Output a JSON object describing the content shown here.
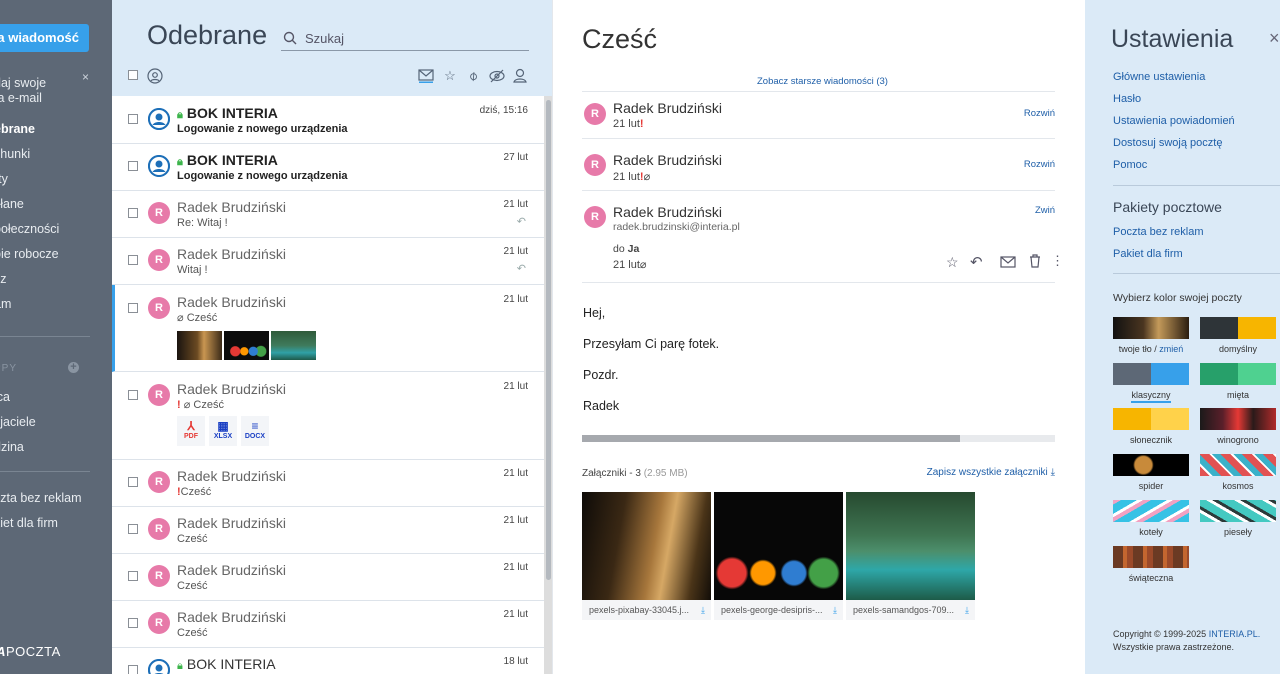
{
  "sidebar": {
    "new_message": "wa wiadomość",
    "promo": [
      "daj swoje",
      "ta e-mail"
    ],
    "promo_close": "×",
    "folders": [
      "ebrane",
      "chunki",
      "rty",
      "słane",
      "połeczności",
      "pie robocze",
      "sz",
      "am"
    ],
    "labels_head": "PPY",
    "labels_add": "+",
    "groups": [
      "ica",
      "yjaciele",
      "dzina"
    ],
    "extras": [
      "czta bez reklam",
      "kiet dla firm"
    ],
    "logo_bold": "IA",
    "logo_text": "POCZTA"
  },
  "list": {
    "title": "Odebrane",
    "search_placeholder": "Szukaj",
    "rows": [
      {
        "avatar": "",
        "sender": "BOK INTERIA",
        "subject": "Logowanie z nowego urządzenia",
        "date": "dziś, 15:16",
        "unread": true,
        "lock": true
      },
      {
        "avatar": "",
        "sender": "BOK INTERIA",
        "subject": "Logowanie z nowego urządzenia",
        "date": "27 lut",
        "unread": true,
        "lock": true
      },
      {
        "avatar": "R",
        "sender": "Radek Brudziński",
        "subject": "Re: Witaj !",
        "date": "21 lut"
      },
      {
        "avatar": "R",
        "sender": "Radek Brudziński",
        "subject": "Witaj !",
        "date": "21 lut"
      },
      {
        "avatar": "R",
        "sender": "Radek Brudziński",
        "subject": "Cześć",
        "date": "21 lut"
      },
      {
        "avatar": "R",
        "sender": "Radek Brudziński",
        "subject": "Cześć",
        "date": "21 lut",
        "files": [
          "PDF",
          "XLSX",
          "DOCX"
        ]
      },
      {
        "avatar": "R",
        "sender": "Radek Brudziński",
        "subject": "Cześć",
        "date": "21 lut"
      },
      {
        "avatar": "R",
        "sender": "Radek Brudziński",
        "subject": "Cześć",
        "date": "21 lut"
      },
      {
        "avatar": "R",
        "sender": "Radek Brudziński",
        "subject": "Cześć",
        "date": "21 lut"
      },
      {
        "avatar": "R",
        "sender": "Radek Brudziński",
        "subject": "Cześć",
        "date": "21 lut"
      },
      {
        "avatar": "",
        "sender": "BOK INTERIA",
        "subject": "",
        "date": "18 lut",
        "lock": true
      }
    ]
  },
  "read": {
    "title": "Cześć",
    "older_link": "Zobacz starsze wiadomości (3)",
    "messages": [
      {
        "avatar": "R",
        "name": "Radek Brudziński",
        "date": "21 lut",
        "action": "Rozwiń"
      },
      {
        "avatar": "R",
        "name": "Radek Brudziński",
        "date": "21 lut",
        "action": "Rozwiń"
      },
      {
        "avatar": "R",
        "name": "Radek Brudziński",
        "email": "radek.brudzinski@interia.pl",
        "to_label": "do",
        "to": "Ja",
        "date": "21 lut",
        "action": "Zwiń"
      }
    ],
    "body": [
      "Hej,",
      "Przesyłam Ci parę fotek.",
      "Pozdr.",
      "Radek"
    ],
    "progress": 0.8,
    "attachments_label": "Załączniki - 3",
    "attachments_size": "(2.95 MB)",
    "save_all": "Zapisz wszystkie załączniki",
    "attachments": [
      "pexels-pixabay-33045.j...",
      "pexels-george-desipris-...",
      "pexels-samandgos-709..."
    ]
  },
  "settings": {
    "title": "Ustawienia",
    "close": "×",
    "links": [
      "Główne ustawienia",
      "Hasło",
      "Ustawienia powiadomień",
      "Dostosuj swoją pocztę",
      "Pomoc"
    ],
    "packages_head": "Pakiety pocztowe",
    "packages": [
      "Poczta bez reklam",
      "Pakiet dla firm"
    ],
    "color_head": "Wybierz kolor swojej poczty",
    "themes": [
      {
        "label": "twoje tło / ",
        "link": "zmień"
      },
      {
        "label": "domyślny"
      },
      {
        "label": "klasyczny"
      },
      {
        "label": "mięta"
      },
      {
        "label": "słonecznik"
      },
      {
        "label": "winogrono"
      },
      {
        "label": "spider"
      },
      {
        "label": "kosmos"
      },
      {
        "label": "koteły"
      },
      {
        "label": "piesełу"
      },
      {
        "label": "świąteczna"
      }
    ],
    "copyright_1": "Copyright © 1999-2025 ",
    "copyright_brand": "INTERIA.PL.",
    "copyright_2": "Wszystkie prawa zastrzeżone."
  },
  "colors": {
    "accent": "#37a0ea",
    "sidebar": "#5d6876",
    "pane": "#dbeaf7",
    "unread_star": "#e53935"
  }
}
